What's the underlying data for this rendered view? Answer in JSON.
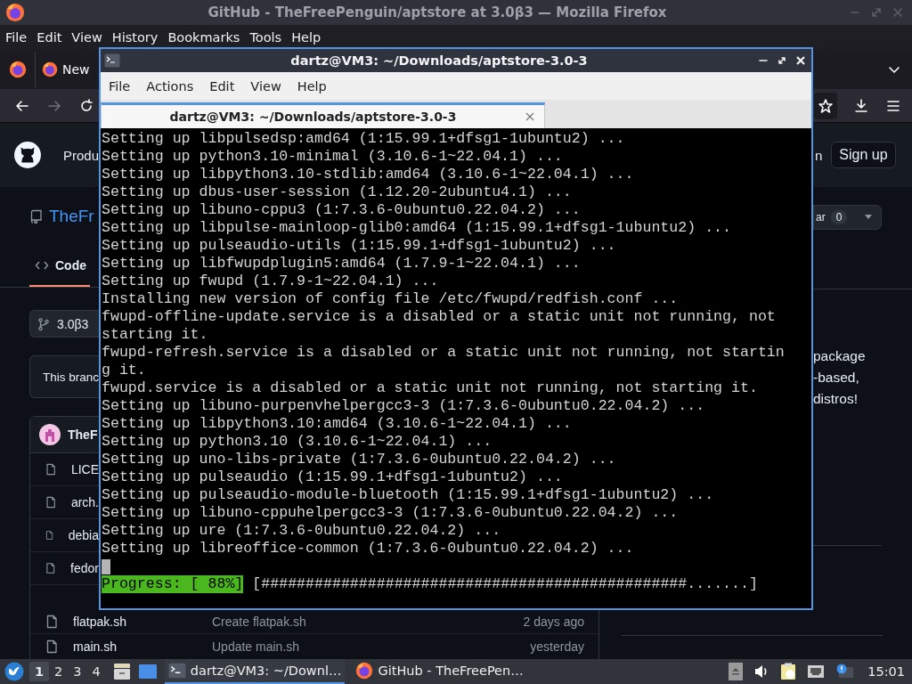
{
  "browser": {
    "title": "GitHub - TheFreePenguin/aptstore at 3.0β3 — Mozilla Firefox",
    "menu": [
      "File",
      "Edit",
      "View",
      "History",
      "Bookmarks",
      "Tools",
      "Help"
    ],
    "tabs": [
      {
        "label": "New",
        "selected": false
      }
    ],
    "nav": {
      "back_disabled": false,
      "forward_disabled": true
    }
  },
  "github": {
    "header": {
      "nav_item": "Produ",
      "sign_in": "n",
      "sign_up": "Sign up"
    },
    "repo": {
      "name": "TheFr",
      "star_label": "ar",
      "star_count": "0"
    },
    "tabs": [
      {
        "label": "Code",
        "selected": true
      }
    ],
    "branch": "3.0β3",
    "notice": "This branc",
    "commit_author": "TheF",
    "files": [
      {
        "name": "LICE"
      },
      {
        "name": "arch."
      },
      {
        "name": "debia"
      },
      {
        "name": "fedor"
      },
      {
        "name": "flatpak.sh",
        "message": "Create flatpak.sh",
        "time": "2 days ago"
      },
      {
        "name": "main.sh",
        "message": "Update main.sh",
        "time": "yesterday"
      }
    ],
    "about_lines": [
      "package",
      "-based,",
      "distros!"
    ]
  },
  "terminal": {
    "title": "dartz@VM3: ~/Downloads/aptstore-3.0-3",
    "menu": [
      "File",
      "Actions",
      "Edit",
      "View",
      "Help"
    ],
    "tabs": [
      {
        "label": "dartz@VM3: ~/Downloads/aptstore-3.0-3",
        "selected": true
      }
    ],
    "lines": [
      "Setting up libpulsedsp:amd64 (1:15.99.1+dfsg1-1ubuntu2) ...",
      "Setting up python3.10-minimal (3.10.6-1~22.04.1) ...",
      "Setting up libpython3.10-stdlib:amd64 (3.10.6-1~22.04.1) ...",
      "Setting up dbus-user-session (1.12.20-2ubuntu4.1) ...",
      "Setting up libuno-cppu3 (1:7.3.6-0ubuntu0.22.04.2) ...",
      "Setting up libpulse-mainloop-glib0:amd64 (1:15.99.1+dfsg1-1ubuntu2) ...",
      "Setting up pulseaudio-utils (1:15.99.1+dfsg1-1ubuntu2) ...",
      "Setting up libfwupdplugin5:amd64 (1.7.9-1~22.04.1) ...",
      "Setting up fwupd (1.7.9-1~22.04.1) ...",
      "Installing new version of config file /etc/fwupd/redfish.conf ...",
      "fwupd-offline-update.service is a disabled or a static unit not running, not",
      "starting it.",
      "fwupd-refresh.service is a disabled or a static unit not running, not startin",
      "g it.",
      "fwupd.service is a disabled or a static unit not running, not starting it.",
      "Setting up libuno-purpenvhelpergcc3-3 (1:7.3.6-0ubuntu0.22.04.2) ...",
      "Setting up libpython3.10:amd64 (3.10.6-1~22.04.1) ...",
      "Setting up python3.10 (3.10.6-1~22.04.1) ...",
      "Setting up uno-libs-private (1:7.3.6-0ubuntu0.22.04.2) ...",
      "Setting up pulseaudio (1:15.99.1+dfsg1-1ubuntu2) ...",
      "Setting up pulseaudio-module-bluetooth (1:15.99.1+dfsg1-1ubuntu2) ...",
      "Setting up libuno-cppuhelpergcc3-3 (1:7.3.6-0ubuntu0.22.04.2) ...",
      "Setting up ure (1:7.3.6-0ubuntu0.22.04.2) ...",
      "Setting up libreoffice-common (1:7.3.6-0ubuntu0.22.04.2) ..."
    ],
    "progress_label": "Progress: [ 88%]",
    "progress_bar": "[################################################.......]"
  },
  "taskbar": {
    "workspaces": [
      {
        "label": "1",
        "selected": true
      },
      {
        "label": "2",
        "selected": false
      },
      {
        "label": "3",
        "selected": false
      },
      {
        "label": "4",
        "selected": false
      }
    ],
    "tasks": [
      {
        "kind": "terminal",
        "label": "dartz@VM3: ~/Downl…",
        "selected": true
      },
      {
        "kind": "browser",
        "label": "GitHub - TheFreePen…",
        "selected": false
      }
    ],
    "clock": "15:01"
  }
}
